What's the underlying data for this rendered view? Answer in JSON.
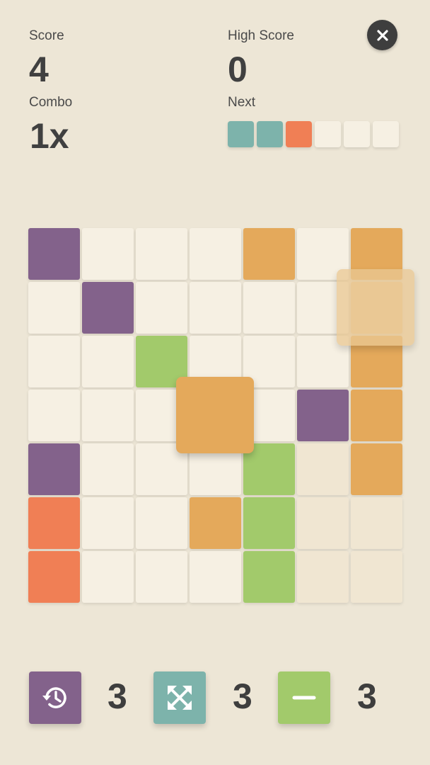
{
  "header": {
    "score_label": "Score",
    "score_value": "4",
    "high_score_label": "High Score",
    "high_score_value": "0",
    "combo_label": "Combo",
    "combo_value": "1x",
    "next_label": "Next",
    "next_queue": [
      "teal",
      "teal",
      "orange",
      "empty",
      "empty",
      "empty"
    ]
  },
  "colors": {
    "background": "#ede6d6",
    "empty": "#f6f0e3",
    "empty_alt": "#f0e6d2",
    "purple": "#83628b",
    "orange": "#f07f55",
    "amber": "#e4a95b",
    "green": "#a2ca6b",
    "teal": "#7db3ab",
    "ghost": "#eac894",
    "dark": "#3e3e3e"
  },
  "board": {
    "size": 7,
    "rows": [
      [
        "purple",
        "empty",
        "empty",
        "empty",
        "amber",
        "empty",
        "amber"
      ],
      [
        "empty",
        "purple",
        "empty",
        "empty",
        "empty",
        "empty",
        "ghost"
      ],
      [
        "empty",
        "empty",
        "green",
        "empty",
        "empty",
        "empty",
        "amber"
      ],
      [
        "empty",
        "empty",
        "empty",
        "empty",
        "empty",
        "purple",
        "amber"
      ],
      [
        "purple",
        "empty",
        "empty",
        "empty",
        "green",
        "empty_alt",
        "amber"
      ],
      [
        "orange",
        "empty",
        "empty",
        "amber",
        "green",
        "empty_alt",
        "empty_alt"
      ],
      [
        "orange",
        "empty",
        "empty",
        "empty",
        "green",
        "empty_alt",
        "empty_alt"
      ]
    ],
    "held_piece_color": "amber",
    "hover_piece_color": "ghost"
  },
  "powerups": [
    {
      "name": "undo",
      "icon": "history-icon",
      "color": "purple",
      "count": "3"
    },
    {
      "name": "shuffle",
      "icon": "expand-arrows-icon",
      "color": "teal",
      "count": "3"
    },
    {
      "name": "clear-line",
      "icon": "minus-icon",
      "color": "green",
      "count": "3"
    }
  ],
  "icons": {
    "close": "close-icon"
  }
}
